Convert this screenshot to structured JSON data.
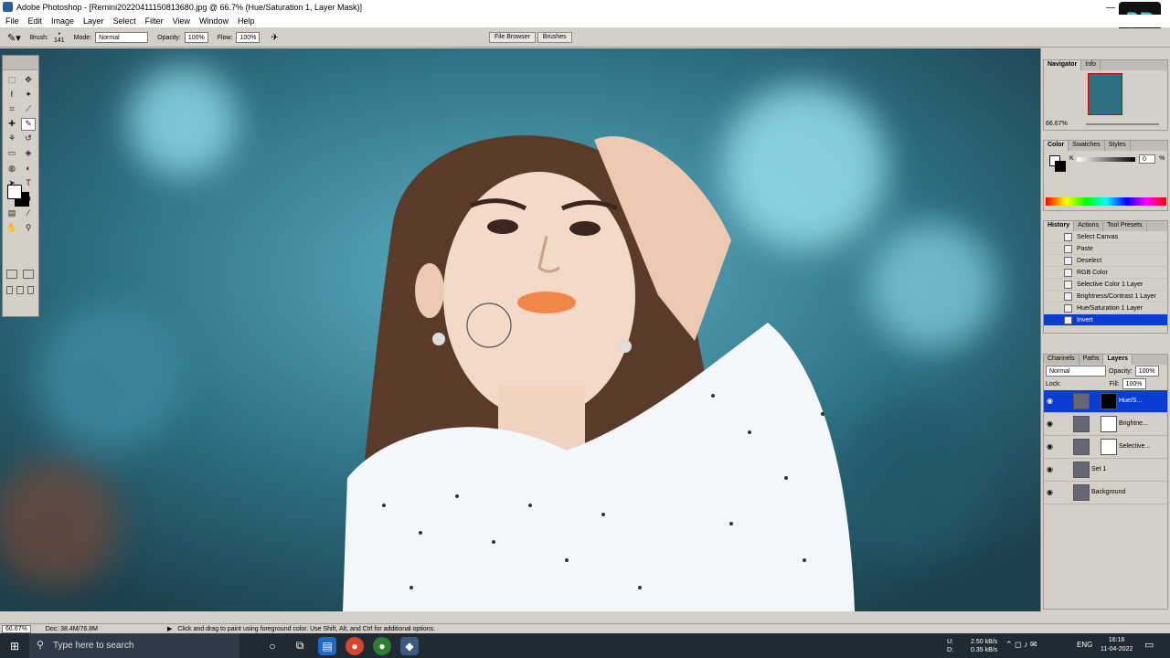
{
  "window": {
    "title": "Adobe Photoshop - [Remini20220411150813680.jpg @ 66.7% (Hue/Saturation 1, Layer Mask)]"
  },
  "menu": [
    "File",
    "Edit",
    "Image",
    "Layer",
    "Select",
    "Filter",
    "View",
    "Window",
    "Help"
  ],
  "options": {
    "brush_label": "Brush:",
    "brush_size": "141",
    "mode_label": "Mode:",
    "mode_value": "Normal",
    "opacity_label": "Opacity:",
    "opacity_value": "100%",
    "flow_label": "Flow:",
    "flow_value": "100%"
  },
  "palette_well": [
    "File Browser",
    "Brushes"
  ],
  "navigator": {
    "tabs": [
      "Navigator",
      "Info"
    ],
    "zoom": "66.67%"
  },
  "color_panel": {
    "tabs": [
      "Color",
      "Swatches",
      "Styles"
    ],
    "channel": "K",
    "value": "0",
    "unit": "%"
  },
  "history": {
    "tabs": [
      "History",
      "Actions",
      "Tool Presets"
    ],
    "items": [
      "Select Canvas",
      "Paste",
      "Deselect",
      "RGB Color",
      "Selective Color 1 Layer",
      "Brightness/Contrast 1 Layer",
      "Hue/Saturation 1 Layer",
      "Invert"
    ],
    "selected": "Invert"
  },
  "layers": {
    "tabs": [
      "Channels",
      "Paths",
      "Layers"
    ],
    "blend_mode": "Normal",
    "opacity_label": "Opacity:",
    "opacity_value": "100%",
    "lock_label": "Lock:",
    "fill_label": "Fill:",
    "fill_value": "100%",
    "rows": [
      {
        "name": "Hue/S...",
        "selected": true
      },
      {
        "name": "Brightne..."
      },
      {
        "name": "Selective..."
      },
      {
        "name": "Set 1"
      },
      {
        "name": "Background"
      }
    ]
  },
  "status": {
    "zoom": "66.67%",
    "doc": "Doc: 38.4M/76.8M",
    "hint": "Click and drag to paint using foreground color.  Use Shift, Alt, and Ctrl for additional options."
  },
  "taskbar": {
    "search_placeholder": "Type here to search",
    "net_up_label": "U:",
    "net_down_label": "D:",
    "net_up": "2.50 kB/s",
    "net_down": "0.35 kB/s",
    "lang": "ENG",
    "time": "16:16",
    "date": "11-04-2022"
  },
  "colors": {
    "accent": "#0a3dd4",
    "teal": "#2e6f82"
  }
}
